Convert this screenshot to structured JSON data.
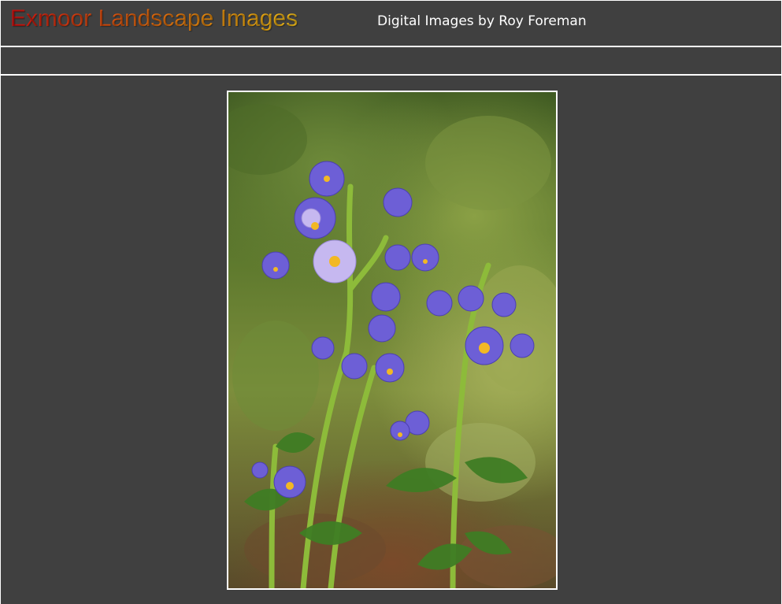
{
  "header": {
    "site_title": "Exmoor Landscape Images",
    "subtitle": "Digital Images by Roy Foreman"
  },
  "photo": {
    "subject": "purple-flowers-photo"
  },
  "colors": {
    "background": "#404040",
    "divider": "#ffffff",
    "title_gradient_start": "#d40f0f",
    "title_gradient_end": "#f7c21a",
    "flower_purple": "#6a5acd"
  }
}
